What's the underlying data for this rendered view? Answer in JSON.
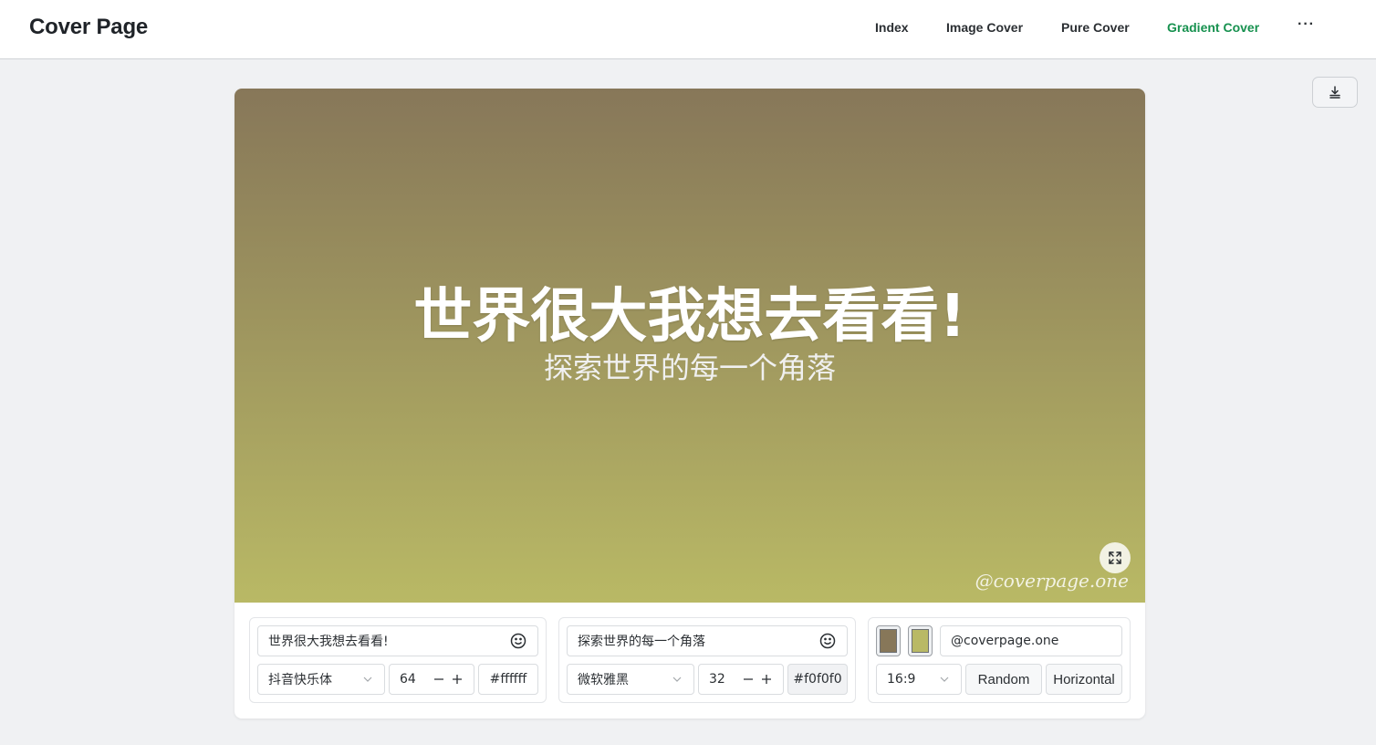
{
  "app": {
    "title": "Cover Page"
  },
  "nav": {
    "items": [
      {
        "label": "Index",
        "active": false
      },
      {
        "label": "Image Cover",
        "active": false
      },
      {
        "label": "Pure Cover",
        "active": false
      },
      {
        "label": "Gradient Cover",
        "active": true
      }
    ],
    "more_label": "···",
    "active_color": "#17914f"
  },
  "toolbar": {
    "download_icon": "download-icon"
  },
  "cover": {
    "title": "世界很大我想去看看!",
    "subtitle": "探索世界的每一个角落",
    "watermark": "@coverpage.one",
    "gradient_start": "#877759",
    "gradient_end": "#b9b965",
    "title_color": "#ffffff",
    "subtitle_color": "#f0f0f0",
    "fullscreen_icon": "expand-icon"
  },
  "title_panel": {
    "text_value": "世界很大我想去看看!",
    "emoji_icon": "smiley-icon",
    "font_value": "抖音快乐体",
    "size_value": "64",
    "color_value": "#ffffff"
  },
  "subtitle_panel": {
    "text_value": "探索世界的每一个角落",
    "emoji_icon": "smiley-icon",
    "font_value": "微软雅黑",
    "size_value": "32",
    "color_value": "#f0f0f0"
  },
  "style_panel": {
    "color_start": "#877759",
    "color_end": "#b9b965",
    "watermark_value": "@coverpage.one",
    "ratio_value": "16:9",
    "random_label": "Random",
    "direction_label": "Horizontal"
  }
}
